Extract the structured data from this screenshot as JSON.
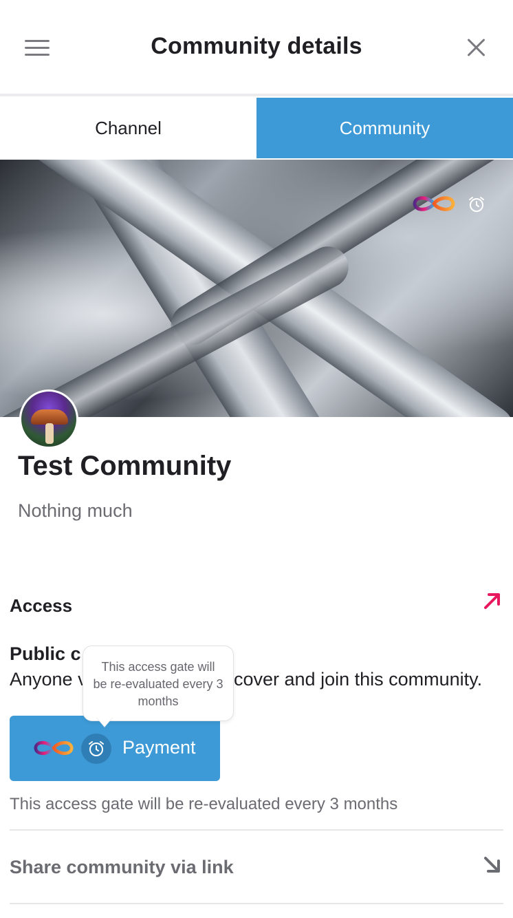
{
  "header": {
    "title": "Community details",
    "menu_icon": "hamburger-menu-icon",
    "close_icon": "close-icon"
  },
  "tabs": [
    {
      "label": "Channel",
      "selected": false
    },
    {
      "label": "Community",
      "selected": true
    }
  ],
  "banner": {
    "icons": [
      "infinity-token-icon",
      "alarm-clock-icon"
    ]
  },
  "community": {
    "name": "Test Community",
    "description": "Nothing much",
    "avatar": "mushroom-avatar"
  },
  "access": {
    "heading": "Access",
    "arrow_icon": "arrow-up-right-icon",
    "gate_title": "Public c",
    "gate_desc_left": "Anyone v",
    "gate_desc_right": "cover and join this community.",
    "payment_button_label": "Payment",
    "tooltip_text": "This access gate will be re-evaluated every 3 months",
    "reevaluation_text": "This access gate will be re-evaluated every 3 months"
  },
  "share": {
    "label": "Share community via link",
    "arrow_icon": "arrow-down-right-icon"
  },
  "colors": {
    "accent": "#3d9ad6",
    "arrow_pink": "#e8185f",
    "muted_text": "#6b6b72"
  }
}
